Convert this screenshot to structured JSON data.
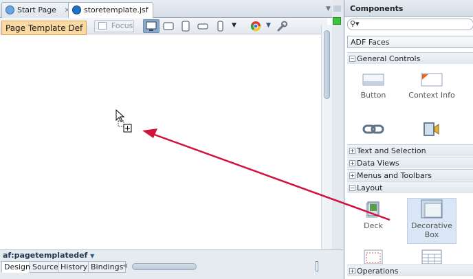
{
  "tabs": [
    {
      "label": "Start Page"
    },
    {
      "label": "storetemplate.jsf"
    }
  ],
  "toolbar": {
    "tooltip": "Page Template Def",
    "focus_label": "Focus"
  },
  "bottom": {
    "breadcrumb": "af:pagetemplatedef",
    "tabs": [
      {
        "label": "Design"
      },
      {
        "label": "Source"
      },
      {
        "label": "History"
      },
      {
        "label": "Bindings"
      }
    ]
  },
  "palette": {
    "title": "Components",
    "library": "ADF Faces",
    "sections": {
      "general_controls": "General Controls",
      "text_selection": "Text and Selection",
      "data_views": "Data Views",
      "menus_toolbars": "Menus and Toolbars",
      "layout": "Layout",
      "operations": "Operations"
    },
    "items": {
      "button": "Button",
      "context_info": "Context Info",
      "deck": "Deck",
      "decorative_box": "Decorative Box"
    }
  },
  "colors": {
    "arrow": "#d0123c",
    "tooltip_bg": "#fbd9a3",
    "selection": "#dae6f6",
    "status_green": "#3cc43c"
  }
}
